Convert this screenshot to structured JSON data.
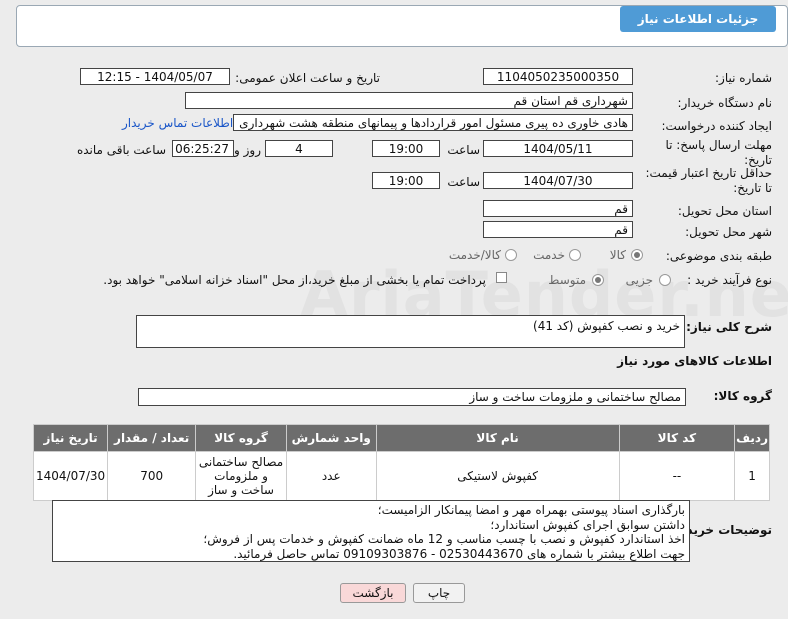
{
  "header": {
    "title": "جزئیات اطلاعات نیاز"
  },
  "labels": {
    "need_number": "شماره نیاز:",
    "announce_datetime": "تاریخ و ساعت اعلان عمومی:",
    "buyer_org": "نام دستگاه خریدار:",
    "requester": "ایجاد کننده درخواست:",
    "reply_deadline": "مهلت ارسال پاسخ: تا تاریخ:",
    "price_validity": "حداقل تاریخ اعتبار قیمت: تا تاریخ:",
    "delivery_province": "استان محل تحویل:",
    "delivery_city": "شهر محل تحویل:",
    "category": "طبقه بندی موضوعی:",
    "process_type": "نوع فرآیند خرید :",
    "time": "ساعت",
    "days_and": "روز و",
    "remaining": "ساعت باقی مانده",
    "need_desc": "شرح کلی نیاز:",
    "goods_info": "اطلاعات کالاهای مورد نیاز",
    "goods_group": "گروه کالا:",
    "buyer_notes": "توضیحات خریدار:"
  },
  "values": {
    "need_number": "1104050235000350",
    "announce_datetime": "1404/05/07 - 12:15",
    "buyer_org": "شهرداری قم استان قم",
    "requester": "هادی خاوری ده پیری مسئول امور قراردادها و پیمانهای منطقه هشت شهرداری",
    "contact_link": "اطلاعات تماس خریدار",
    "reply_date": "1404/05/11",
    "reply_time": "19:00",
    "reply_days": "4",
    "reply_remaining": "06:25:27",
    "price_date": "1404/07/30",
    "price_time": "19:00",
    "province": "قم",
    "city": "قم",
    "need_desc": "خرید و نصب کفپوش (کد 41)",
    "goods_group": "مصالح ساختمانی و ملزومات ساخت و ساز"
  },
  "category_options": {
    "goods": "کالا",
    "service": "خدمت",
    "goods_service": "کالا/خدمت",
    "selected": "کالا"
  },
  "process_options": {
    "minor": "جزیی",
    "medium": "متوسط",
    "selected": "متوسط"
  },
  "payment_note": "پرداخت تمام یا بخشی از مبلغ خرید،از محل \"اسناد خزانه اسلامی\" خواهد بود.",
  "table": {
    "headers": [
      "ردیف",
      "کد کالا",
      "نام کالا",
      "واحد شمارش",
      "گروه کالا",
      "تعداد / مقدار",
      "تاریخ نیاز"
    ],
    "rows": [
      [
        "1",
        "--",
        "کفپوش لاستیکی",
        "عدد",
        "مصالح ساختمانی و ملزومات ساخت و ساز",
        "700",
        "1404/07/30"
      ]
    ]
  },
  "buyer_notes": [
    "بارگذاری اسناد پیوستی بهمراه مهر و امضا پیمانکار الزامیست؛",
    "داشتن سوابق اجرای کفپوش استاندارد؛",
    "اخذ استاندارد کفپوش و نصب با چسب مناسب و 12 ماه ضمانت کفپوش و خدمات پس از فروش؛",
    "جهت اطلاع بیشتر با شماره های 02530443670 - 09109303876 تماس حاصل فرمائید."
  ],
  "buttons": {
    "print": "چاپ",
    "back": "بازگشت"
  },
  "watermark": "AriaTender.neT",
  "colors": {
    "header_bg": "#4f9bd6",
    "table_header_bg": "#6d6d6d",
    "link": "#1a56c8",
    "back_button_bg": "#f9d8d8"
  }
}
